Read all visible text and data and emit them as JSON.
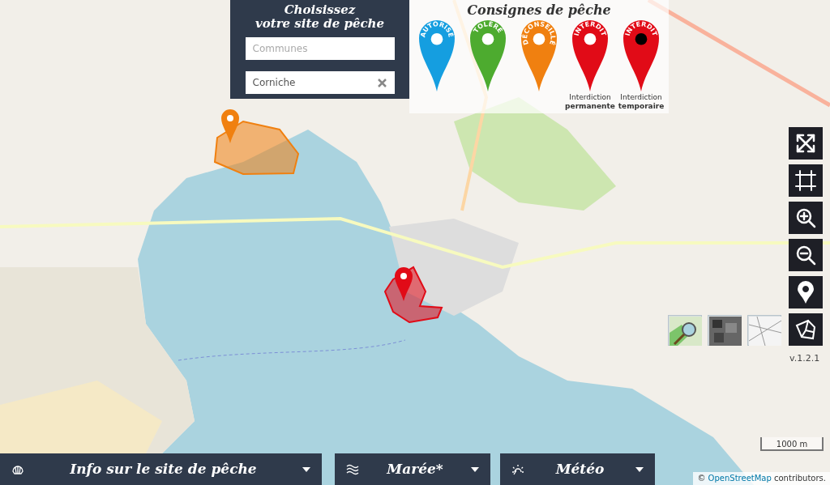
{
  "search_panel": {
    "title_lines": [
      "Choisissez",
      "votre site de pêche"
    ],
    "fields": [
      {
        "placeholder": "Communes"
      },
      {
        "value": "Corniche",
        "clearable": true
      }
    ]
  },
  "legend": {
    "title": "Consignes de pêche",
    "pins": [
      {
        "label": "AUTORISÉ",
        "color": "#159ee0",
        "kind": "hollow"
      },
      {
        "label": "TOLÉRÉ",
        "color": "#4dab2f",
        "kind": "hollow"
      },
      {
        "label": "DÉCONSEILLÉ",
        "color": "#f08010",
        "kind": "hollow"
      },
      {
        "label": "INTERDIT",
        "color": "#e10b17",
        "kind": "hollow",
        "caption": "Interdiction",
        "caption_bold": "permanente"
      },
      {
        "label": "INTERDIT",
        "color": "#e10b17",
        "kind": "filled",
        "caption": "Interdiction",
        "caption_bold": "temporaire"
      }
    ]
  },
  "map_zones": [
    {
      "color": "#f08010"
    },
    {
      "color": "#e10b17"
    }
  ],
  "map_controls": [
    {
      "kind": "fullscreen"
    },
    {
      "kind": "frame"
    },
    {
      "kind": "zoom_in"
    },
    {
      "kind": "zoom_out"
    },
    {
      "kind": "locate"
    },
    {
      "kind": "map"
    }
  ],
  "layer_thumbnails": [
    {
      "kind": "osm"
    },
    {
      "kind": "aerial"
    },
    {
      "kind": "plan"
    }
  ],
  "version": "v.1.2.1",
  "scale": "1000 m",
  "bottom_bar": [
    {
      "kind": "shell",
      "label": "Info sur le site de pêche"
    },
    {
      "kind": "tide",
      "label": "Marée*"
    },
    {
      "kind": "weather",
      "label": "Météo"
    }
  ],
  "attribution": {
    "prefix": "©",
    "link": "OpenStreetMap",
    "suffix": "contributors."
  }
}
